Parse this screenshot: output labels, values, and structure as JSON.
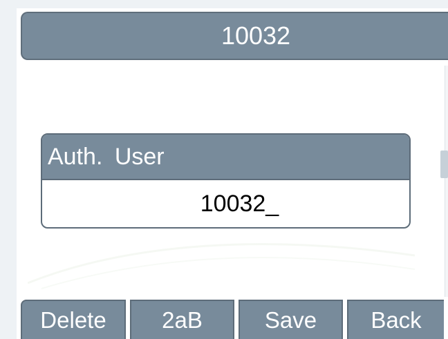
{
  "title_bar": {
    "title": "10032"
  },
  "field": {
    "label": "Auth. User",
    "value": "10032_"
  },
  "softkeys": [
    {
      "label": "Delete"
    },
    {
      "label": "2aB"
    },
    {
      "label": "Save"
    },
    {
      "label": "Back"
    }
  ],
  "colors": {
    "bar": "#788b9b",
    "border": "#5d6c79",
    "background": "#ffffff"
  }
}
